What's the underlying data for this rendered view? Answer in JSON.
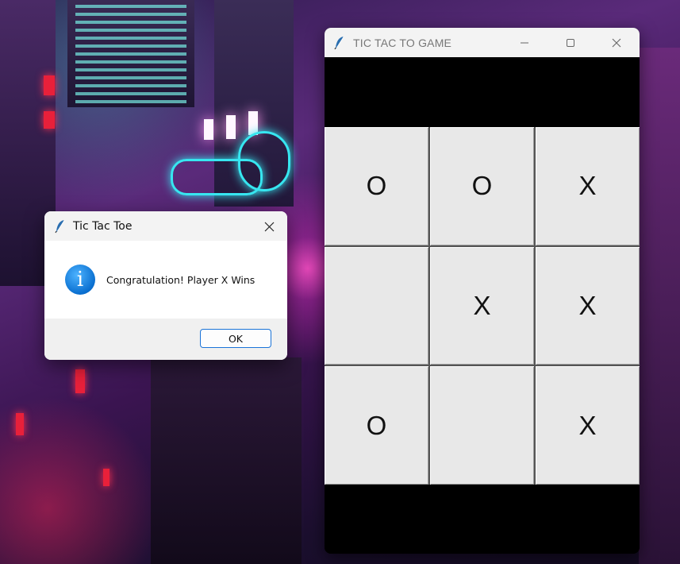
{
  "game_window": {
    "title": "TIC TAC TO GAME",
    "controls": {
      "minimize": "minimize",
      "maximize": "maximize",
      "close": "close"
    },
    "board": [
      [
        "O",
        "O",
        "X"
      ],
      [
        "",
        "X",
        "X"
      ],
      [
        "O",
        "",
        "X"
      ]
    ]
  },
  "dialog": {
    "title": "Tic Tac Toe",
    "message": "Congratulation! Player X Wins",
    "ok_label": "OK",
    "icon": "info-icon"
  },
  "colors": {
    "cell_bg": "#e8e8e8",
    "window_bg": "#000000",
    "accent": "#1a73d8"
  }
}
